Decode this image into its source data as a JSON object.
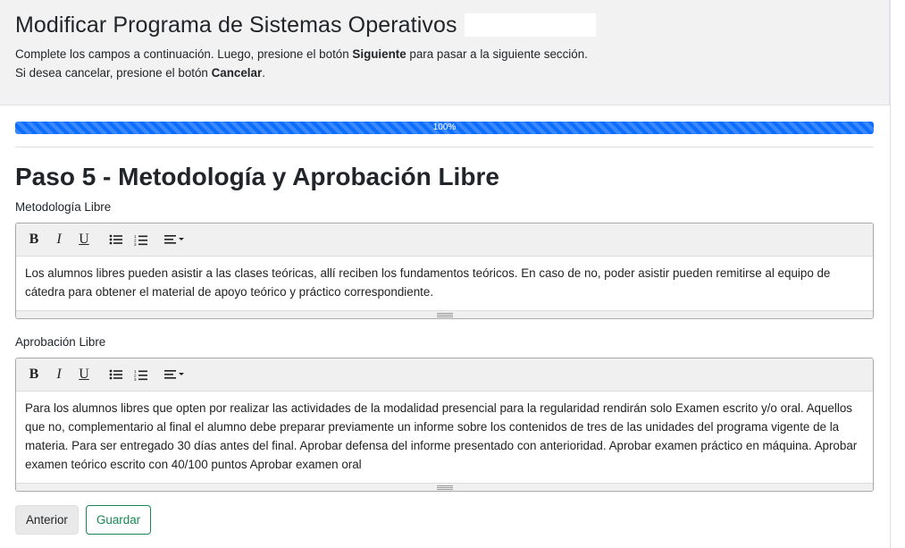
{
  "header": {
    "title": "Modificar Programa de Sistemas Operativos",
    "intro_line1_pre": "Complete los campos a continuación. Luego, presione el botón ",
    "intro_line1_bold": "Siguiente",
    "intro_line1_post": " para pasar a la siguiente sección.",
    "intro_line2_pre": "Si desea cancelar, presione el botón ",
    "intro_line2_bold": "Cancelar",
    "intro_line2_post": "."
  },
  "progress": {
    "value": 100,
    "label": "100%",
    "color": "#0d6efd"
  },
  "step": {
    "title": "Paso 5 - Metodología y Aprobación Libre"
  },
  "toolbar_icons": [
    "bold-icon",
    "italic-icon",
    "underline-icon",
    "bullet-list-icon",
    "numbered-list-icon",
    "align-icon"
  ],
  "fields": [
    {
      "label": "Metodología Libre",
      "value": "Los alumnos libres pueden asistir a las clases teóricas, allí reciben los fundamentos teóricos. En caso de no, poder asistir pueden remitirse al equipo de cátedra para obtener el material de apoyo teórico y práctico correspondiente."
    },
    {
      "label": "Aprobación Libre",
      "value": "Para los alumnos libres que opten por realizar las actividades de la modalidad presencial para la regularidad rendirán solo Examen escrito y/o oral. Aquellos que no, complementario al final el alumno debe preparar previamente un informe sobre los contenidos de tres de las unidades del programa vigente de la materia. Para ser entregado 30 días antes del final. Aprobar defensa del informe presentado con anterioridad. Aprobar examen práctico en máquina. Aprobar examen teórico escrito con 40/100 puntos Aprobar examen oral"
    }
  ],
  "buttons": {
    "prev": "Anterior",
    "save": "Guardar"
  },
  "colors": {
    "save_border": "#198754",
    "header_bg": "#f2f2f2"
  }
}
